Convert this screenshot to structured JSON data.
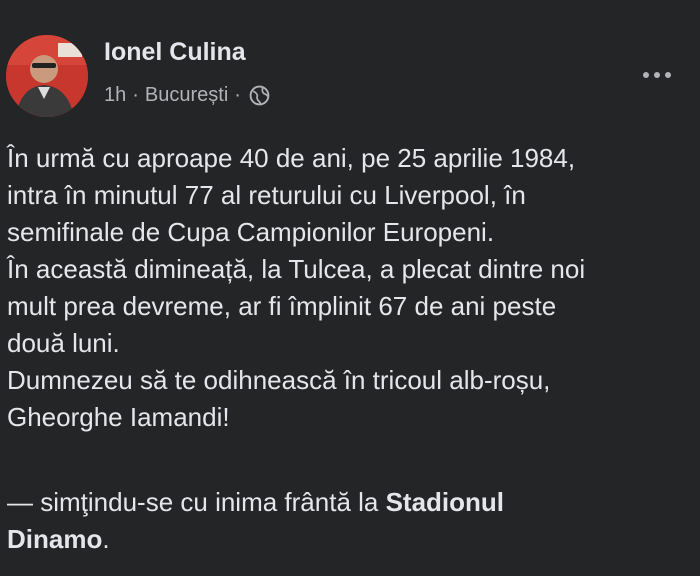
{
  "post": {
    "author": "Ionel Culina",
    "time": "1h",
    "separator": "·",
    "location": "București",
    "separator2": "·",
    "icons": {
      "avatar": "profile-photo",
      "audience": "globe-icon",
      "more": "more-options-icon"
    },
    "lines": [
      "În urmă cu aproape 40 de ani, pe 25 aprilie 1984,",
      "intra în minutul 77 al returului cu Liverpool, în",
      "semifinale de Cupa Campionilor Europeni.",
      "În această dimineață, la Tulcea, a plecat dintre noi",
      "mult prea devreme, ar fi împlinit 67 de ani peste",
      "două luni.",
      "Dumnezeu să te odihnească în tricoul alb-roșu,",
      "Gheorghe Iamandi!"
    ],
    "activity_prefix": "— simţindu-se cu inima frântă la ",
    "activity_place_1": "Stadionul",
    "activity_place_2": "Dinamo",
    "activity_suffix": "."
  }
}
